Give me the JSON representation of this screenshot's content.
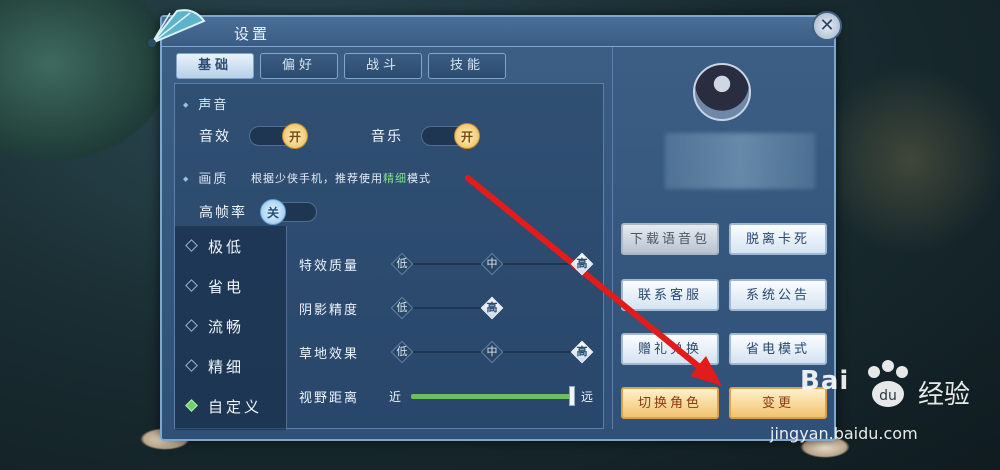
{
  "window": {
    "title": "设置"
  },
  "tabs": [
    {
      "label": "基础",
      "active": true
    },
    {
      "label": "偏好",
      "active": false
    },
    {
      "label": "战斗",
      "active": false
    },
    {
      "label": "技能",
      "active": false
    }
  ],
  "sound": {
    "section_label": "声音",
    "sfx_label": "音效",
    "sfx_state": "开",
    "music_label": "音乐",
    "music_state": "开"
  },
  "graphics": {
    "section_label": "画质",
    "hint_prefix": "根据少侠手机，推荐使用",
    "hint_highlight": "精细",
    "hint_suffix": "模式",
    "fps_label": "高帧率",
    "fps_state": "关"
  },
  "quality_presets": [
    {
      "label": "极低",
      "selected": false
    },
    {
      "label": "省电",
      "selected": false
    },
    {
      "label": "流畅",
      "selected": false
    },
    {
      "label": "精细",
      "selected": false
    },
    {
      "label": "自定义",
      "selected": true
    }
  ],
  "sliders": [
    {
      "label": "特效质量",
      "options": [
        "低",
        "中",
        "高"
      ],
      "selected": "高"
    },
    {
      "label": "阴影精度",
      "options": [
        "低",
        "高"
      ],
      "selected": "高"
    },
    {
      "label": "草地效果",
      "options": [
        "低",
        "中",
        "高"
      ],
      "selected": "高"
    }
  ],
  "view_distance": {
    "label": "视野距离",
    "near": "近",
    "far": "远",
    "level": 1.0
  },
  "side_buttons": {
    "download_voice": "下载语音包",
    "unstuck": "脱离卡死",
    "contact_support": "联系客服",
    "announcement": "系统公告",
    "gift_exchange": "赠礼兑换",
    "power_saving": "省电模式",
    "switch_character": "切换角色",
    "change_server": "变更"
  },
  "watermark": {
    "logo": "Bai",
    "brand": "经验",
    "url": "jingyan.baidu.com"
  },
  "colors": {
    "panel": "#345883",
    "accent_gold": "#f1c46f",
    "highlight_green": "#7fe08a",
    "arrow_red": "#e21b1b"
  }
}
